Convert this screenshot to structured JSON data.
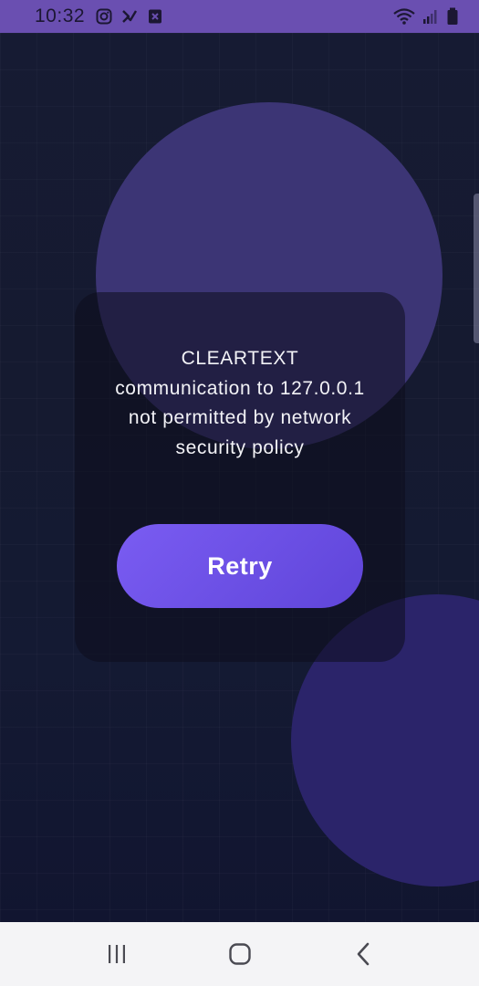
{
  "status_bar": {
    "time": "10:32",
    "left_icons": [
      "instagram-icon",
      "checkmark-app-icon",
      "box-x-icon"
    ],
    "right_icons": [
      "wifi-icon",
      "signal-icon",
      "battery-icon"
    ],
    "background_color": "#6a4fb1"
  },
  "error_screen": {
    "message": "CLEARTEXT communication to 127.0.0.1 not permitted by network security policy",
    "retry_label": "Retry"
  },
  "colors": {
    "accent": "#6b4fe6",
    "background": "#151a30",
    "decor_circle_top": "#3c3575",
    "decor_circle_bottom": "#2b246a"
  },
  "nav_bar": {
    "buttons": [
      "recent-apps-icon",
      "home-icon",
      "back-icon"
    ]
  }
}
